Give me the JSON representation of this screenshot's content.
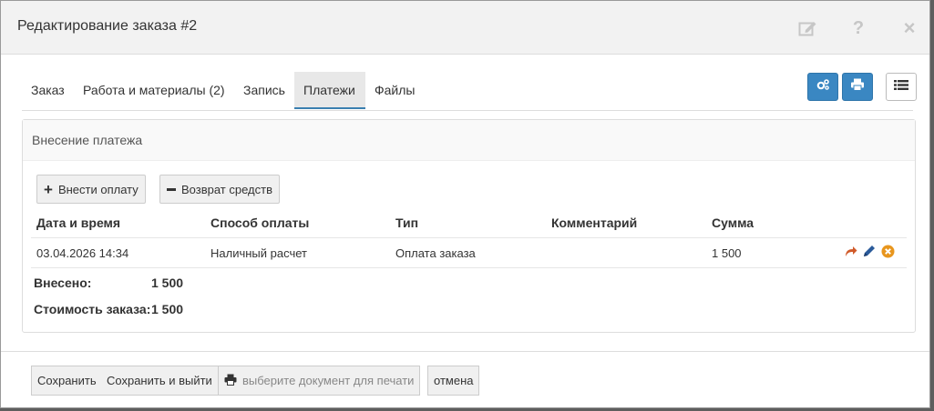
{
  "modal": {
    "title": "Редактирование заказа #2"
  },
  "header_icons": [
    "edit-icon",
    "help-icon",
    "close-icon"
  ],
  "header_glyphs": {
    "help": "?",
    "close": "×"
  },
  "tabs": [
    {
      "label": "Заказ",
      "active": false
    },
    {
      "label": "Работа и материалы (2)",
      "active": false
    },
    {
      "label": "Запись",
      "active": false
    },
    {
      "label": "Платежи",
      "active": true
    },
    {
      "label": "Файлы",
      "active": false
    }
  ],
  "toolbar_icons": [
    "settings-gears-icon",
    "print-icon",
    "list-icon"
  ],
  "panel": {
    "title": "Внесение платежа",
    "add_payment_label": "Внести оплату",
    "refund_label": "Возврат средств"
  },
  "table": {
    "columns": [
      "Дата и время",
      "Способ оплаты",
      "Тип",
      "Комментарий",
      "Сумма"
    ],
    "rows": [
      {
        "datetime": "03.04.2026 14:34",
        "method": "Наличный расчет",
        "type": "Оплата заказа",
        "comment": "",
        "amount": "1 500",
        "actions": [
          "share-arrow-icon",
          "edit-pencil-icon",
          "delete-circle-icon"
        ]
      }
    ]
  },
  "totals": {
    "paid_label": "Внесено:",
    "paid_value": "1 500",
    "cost_label": "Стоимость заказа:",
    "cost_value": "1 500"
  },
  "footer": {
    "save_label": "Сохранить",
    "save_exit_label": "Сохранить и выйти",
    "print_doc_label": "выберите документ для печати",
    "cancel_label": "отмена"
  },
  "colors": {
    "accent": "#3a87c2",
    "action_arrow": "#d05a2a",
    "action_pencil": "#2a5a9a",
    "action_delete": "#e8961e"
  }
}
